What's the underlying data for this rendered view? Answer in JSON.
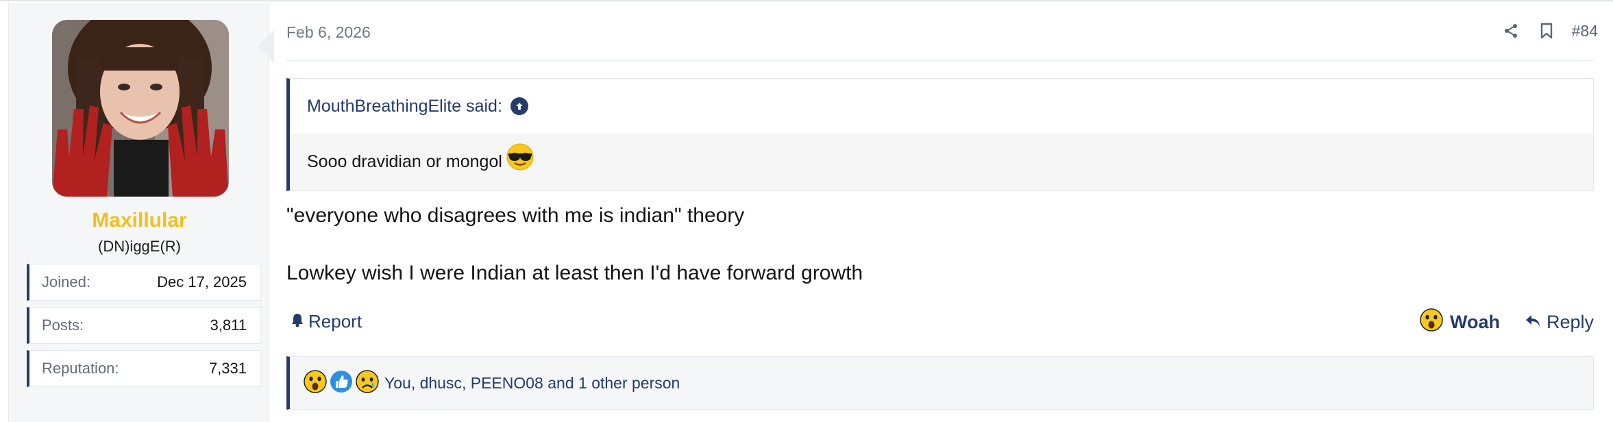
{
  "user": {
    "name": "Maxillular",
    "title": "(DN)iggE(R)",
    "stats": [
      {
        "label": "Joined:",
        "value": "Dec 17, 2025"
      },
      {
        "label": "Posts:",
        "value": "3,811"
      },
      {
        "label": "Reputation:",
        "value": "7,331"
      }
    ]
  },
  "post": {
    "date": "Feb 6, 2026",
    "number": "#84",
    "quote": {
      "attribution": "MouthBreathingElite said:",
      "text": "Sooo dravidian or mongol"
    },
    "body": [
      "\"everyone who disagrees with me is indian\" theory",
      "Lowkey wish I were Indian at least then I'd have forward growth"
    ],
    "actions": {
      "report": "Report",
      "reaction": "Woah",
      "reply": "Reply"
    },
    "reactions_summary": "You, dhusc, PEENO08 and 1 other person"
  },
  "colors": {
    "accent": "#243b6b",
    "username": "#f4bf1a",
    "sidebar_bg": "#f5f6f8"
  },
  "icons": [
    "share-icon",
    "bookmark-icon",
    "arrow-up-circle-icon",
    "sunglasses-emoji-icon",
    "bell-icon",
    "wow-emoji-icon",
    "reply-arrow-icon",
    "like-emoji-icon",
    "sad-emoji-icon"
  ]
}
